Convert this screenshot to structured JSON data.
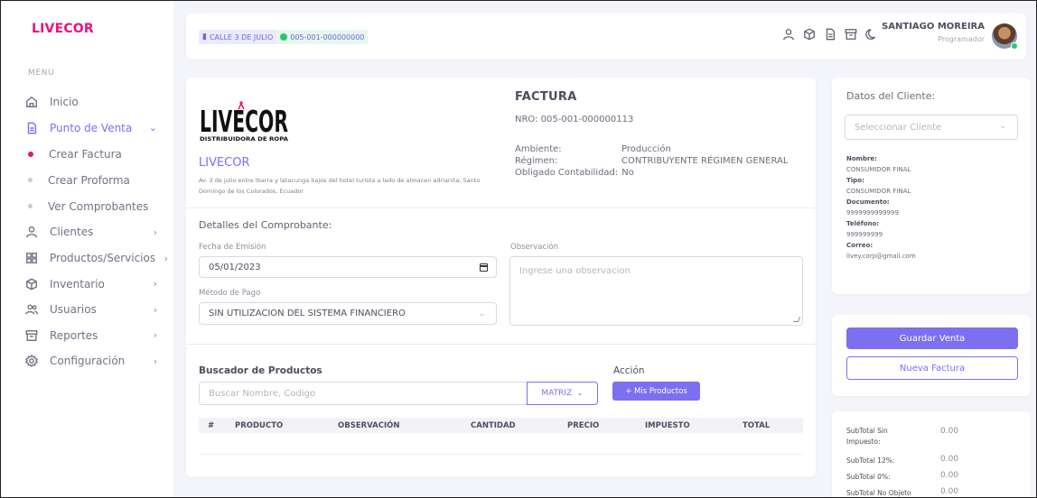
{
  "brand": "LIVECOR",
  "menu_label": "MENU",
  "nav": {
    "inicio": "Inicio",
    "punto_de_venta": "Punto de Venta",
    "sub": [
      "Crear Factura",
      "Crear Proforma",
      "Ver Comprobantes"
    ],
    "clientes": "Clientes",
    "productos": "Productos/Servicios",
    "inventario": "Inventario",
    "usuarios": "Usuarios",
    "reportes": "Reportes",
    "configuracion": "Configuración"
  },
  "topbar": {
    "location": "CALLE 3 DE JULIO",
    "point": "005-001-000000000",
    "user_name": "SANTIAGO MOREIRA",
    "user_role": "Programador"
  },
  "invoice": {
    "logo_text": "LIVECOR",
    "logo_subtitle": "DISTRIBUIDORA DE ROPA",
    "company": "LIVECOR",
    "address": "Av. 3 de julio entre Ibarra y latacunga bajos del hotel turista a lado de almacen adrianita, Santo Domingo de los Colorados, Ecuador",
    "title": "FACTURA",
    "nro": "NRO: 005-001-000000113",
    "ambiente_label": "Ambiente:",
    "ambiente_value": "Producción",
    "regimen_label": "Régimen:",
    "regimen_value": "CONTRIBUYENTE RÉGIMEN GENERAL",
    "obligado_label": "Obligado Contabilidad:",
    "obligado_value": "No"
  },
  "details": {
    "title": "Detalles del Comprobante:",
    "fecha_label": "Fecha de Emisión",
    "fecha_value": "05/01/2023",
    "metodo_label": "Método de Pago",
    "metodo_value": "SIN UTILIZACION DEL SISTEMA FINANCIERO",
    "obs_label": "Observación",
    "obs_placeholder": "Ingrese una observacion"
  },
  "search": {
    "title": "Buscador de Productos",
    "placeholder": "Buscar Nombre, Codigo",
    "matriz": "MATRIZ",
    "accion_label": "Acción",
    "mis_productos": "+ Mis Productos"
  },
  "table_headers": [
    "#",
    "PRODUCTO",
    "OBSERVACIÓN",
    "CANTIDAD",
    "PRECIO",
    "IMPUESTO",
    "TOTAL"
  ],
  "client": {
    "title": "Datos del Cliente:",
    "select_placeholder": "Seleccionar Cliente",
    "fields": [
      {
        "label": "Nombre:",
        "value": "CONSUMIDOR FINAL"
      },
      {
        "label": "Tipo:",
        "value": "CONSUMIDOR FINAL"
      },
      {
        "label": "Documento:",
        "value": "9999999999999"
      },
      {
        "label": "Teléfono:",
        "value": "999999999"
      },
      {
        "label": "Correo:",
        "value": "livey.corp@gmail.com"
      }
    ]
  },
  "actions": {
    "save": "Guardar Venta",
    "new": "Nueva Factura"
  },
  "totals": [
    {
      "label": "SubTotal Sin Impuesto:",
      "value": "0.00"
    },
    {
      "label": "SubTotal 12%:",
      "value": "0.00"
    },
    {
      "label": "SubTotal 0%:",
      "value": "0.00"
    },
    {
      "label": "SubTotal No Objeto",
      "value": "0.00"
    }
  ],
  "colors": {
    "accent": "#7c6ff0",
    "brand": "#e8127b",
    "online": "#28c76f"
  }
}
